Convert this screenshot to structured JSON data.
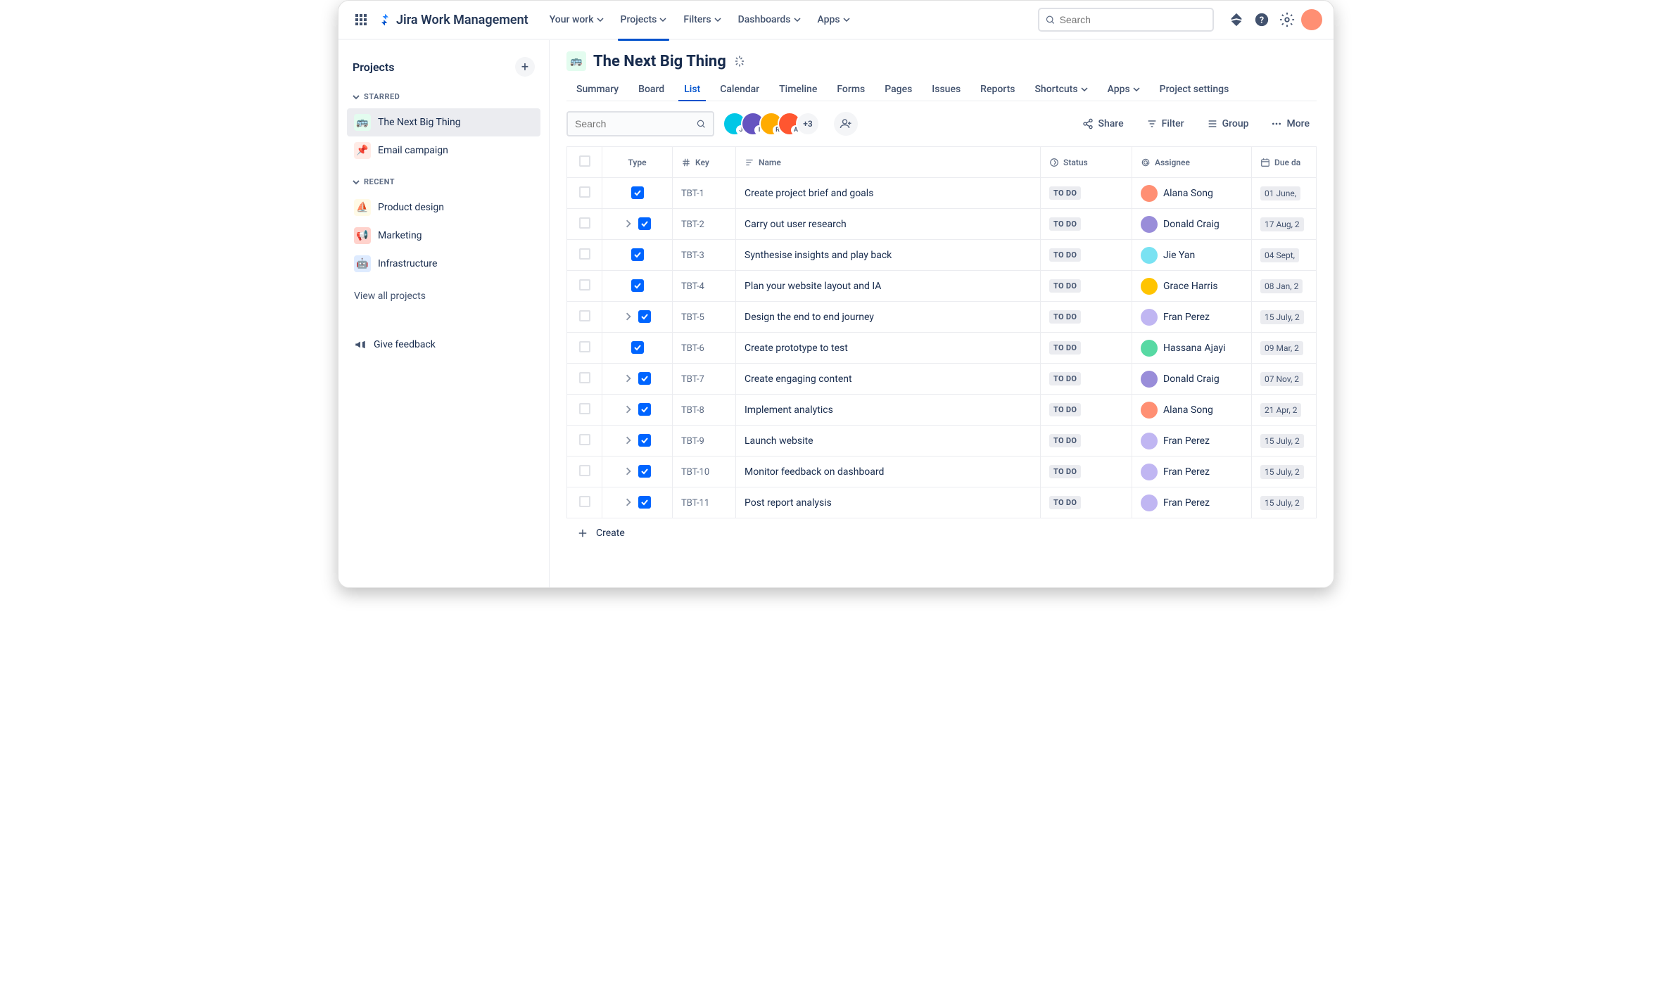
{
  "topbar": {
    "product_name": "Jira Work Management",
    "nav": [
      {
        "label": "Your work",
        "dropdown": true
      },
      {
        "label": "Projects",
        "dropdown": true,
        "active": true
      },
      {
        "label": "Filters",
        "dropdown": true
      },
      {
        "label": "Dashboards",
        "dropdown": true
      },
      {
        "label": "Apps",
        "dropdown": true
      }
    ],
    "search_placeholder": "Search"
  },
  "sidebar": {
    "title": "Projects",
    "starred_label": "STARRED",
    "recent_label": "RECENT",
    "starred": [
      {
        "label": "The Next Big Thing",
        "emoji": "🚌",
        "cls": "pi-teal",
        "active": true
      },
      {
        "label": "Email campaign",
        "emoji": "📌",
        "cls": "pi-pink"
      }
    ],
    "recent": [
      {
        "label": "Product design",
        "emoji": "⛵",
        "cls": "pi-yellow"
      },
      {
        "label": "Marketing",
        "emoji": "📢",
        "cls": "pi-red"
      },
      {
        "label": "Infrastructure",
        "emoji": "🤖",
        "cls": "pi-blue"
      }
    ],
    "view_all": "View all projects",
    "feedback": "Give feedback"
  },
  "project": {
    "emoji": "🚌",
    "title": "The Next Big Thing",
    "tabs": [
      {
        "label": "Summary"
      },
      {
        "label": "Board"
      },
      {
        "label": "List",
        "active": true
      },
      {
        "label": "Calendar"
      },
      {
        "label": "Timeline"
      },
      {
        "label": "Forms"
      },
      {
        "label": "Pages"
      },
      {
        "label": "Issues"
      },
      {
        "label": "Reports"
      },
      {
        "label": "Shortcuts",
        "dropdown": true
      },
      {
        "label": "Apps",
        "dropdown": true
      },
      {
        "label": "Project settings"
      }
    ]
  },
  "toolbar": {
    "search_placeholder": "Search",
    "avatar_more": "+3",
    "share": "Share",
    "filter": "Filter",
    "group": "Group",
    "more": "More"
  },
  "columns": {
    "type": "Type",
    "key": "Key",
    "name": "Name",
    "status": "Status",
    "assignee": "Assignee",
    "due": "Due da"
  },
  "rows": [
    {
      "key": "TBT-1",
      "name": "Create project brief and goals",
      "status": "TO DO",
      "assignee": "Alana Song",
      "due": "01 June,",
      "expandable": false,
      "av": "aa-1"
    },
    {
      "key": "TBT-2",
      "name": "Carry out user research",
      "status": "TO DO",
      "assignee": "Donald Craig",
      "due": "17 Aug, 2",
      "expandable": true,
      "av": "aa-2"
    },
    {
      "key": "TBT-3",
      "name": "Synthesise insights and play back",
      "status": "TO DO",
      "assignee": "Jie Yan",
      "due": "04 Sept,",
      "expandable": false,
      "av": "aa-3"
    },
    {
      "key": "TBT-4",
      "name": "Plan your website layout and IA",
      "status": "TO DO",
      "assignee": "Grace Harris",
      "due": "08 Jan, 2",
      "expandable": false,
      "av": "aa-4"
    },
    {
      "key": "TBT-5",
      "name": "Design the end to end journey",
      "status": "TO DO",
      "assignee": "Fran Perez",
      "due": "15 July, 2",
      "expandable": true,
      "av": "aa-5"
    },
    {
      "key": "TBT-6",
      "name": "Create prototype to test",
      "status": "TO DO",
      "assignee": "Hassana Ajayi",
      "due": "09 Mar, 2",
      "expandable": false,
      "av": "aa-6"
    },
    {
      "key": "TBT-7",
      "name": "Create engaging content",
      "status": "TO DO",
      "assignee": "Donald Craig",
      "due": "07 Nov, 2",
      "expandable": true,
      "av": "aa-2"
    },
    {
      "key": "TBT-8",
      "name": "Implement analytics",
      "status": "TO DO",
      "assignee": "Alana Song",
      "due": "21 Apr, 2",
      "expandable": true,
      "av": "aa-1"
    },
    {
      "key": "TBT-9",
      "name": "Launch website",
      "status": "TO DO",
      "assignee": "Fran Perez",
      "due": "15 July, 2",
      "expandable": true,
      "av": "aa-5"
    },
    {
      "key": "TBT-10",
      "name": "Monitor feedback on dashboard",
      "status": "TO DO",
      "assignee": "Fran Perez",
      "due": "15 July, 2",
      "expandable": true,
      "av": "aa-5"
    },
    {
      "key": "TBT-11",
      "name": "Post report analysis",
      "status": "TO DO",
      "assignee": "Fran Perez",
      "due": "15 July, 2",
      "expandable": true,
      "av": "aa-5"
    }
  ],
  "create_label": "Create"
}
